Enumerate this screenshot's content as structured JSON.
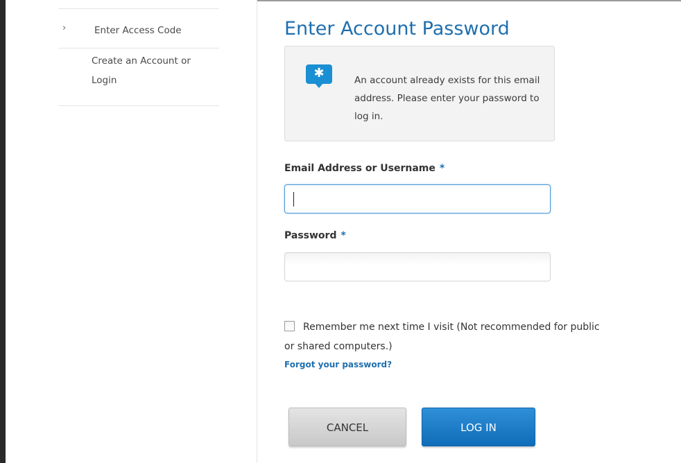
{
  "sidebar": {
    "items": [
      {
        "label": "Enter Access Code",
        "chevron": "›"
      },
      {
        "label": "Create an Account or Login"
      }
    ]
  },
  "page": {
    "title": "Enter Account Password"
  },
  "notice": {
    "icon": "info-speech-bubble-icon",
    "glyph": "✱",
    "text": "An account already exists for this email address. Please enter your password to log in."
  },
  "form": {
    "email_label": "Email Address or Username",
    "password_label": "Password",
    "required_marker": "*",
    "email_value": "",
    "password_value": "",
    "remember_label": "Remember me next time I visit (Not recommended for public or shared computers.)",
    "remember_checked": false,
    "forgot_link": "Forgot your password?"
  },
  "buttons": {
    "cancel": "CANCEL",
    "login": "LOG IN"
  },
  "colors": {
    "accent": "#1f6fae",
    "login_button": "#1a7ac6",
    "cancel_button": "#d6d6d6",
    "notice_bg": "#f3f3f3"
  }
}
